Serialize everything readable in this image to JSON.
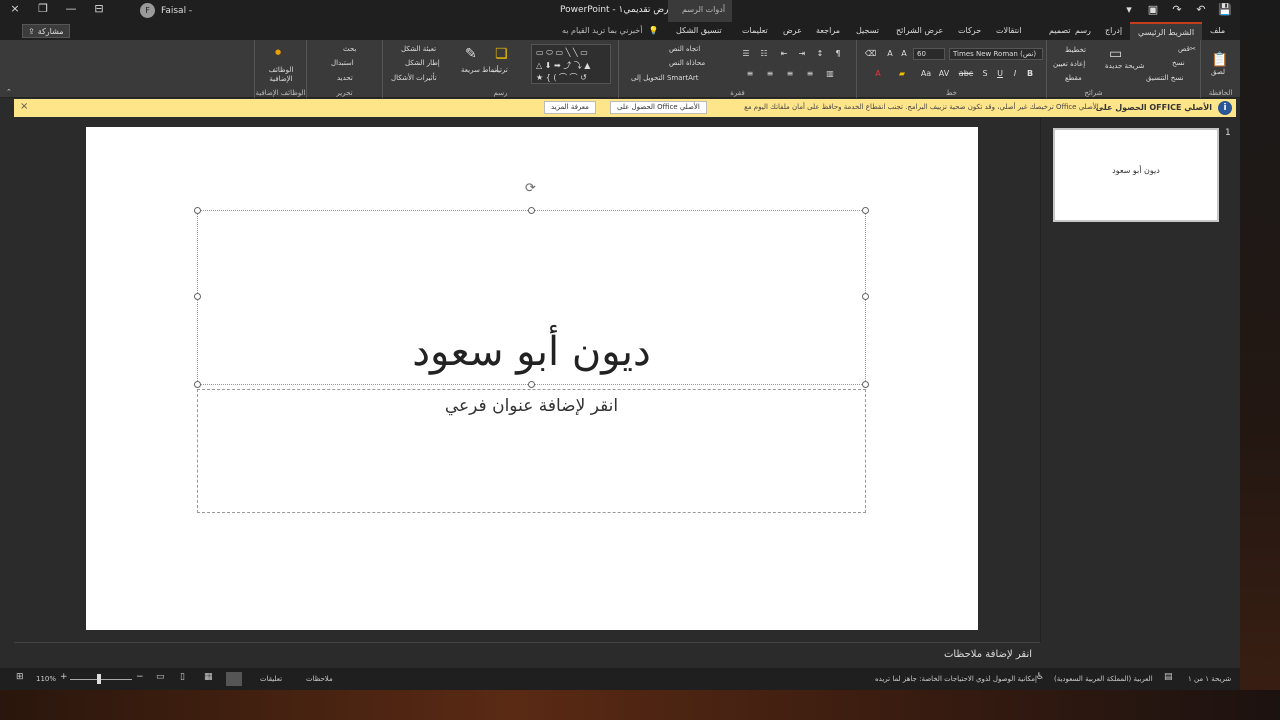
{
  "window": {
    "title": "عرض تقديمي١ - PowerPoint",
    "user_name": "Faisal -",
    "user_initial": "F",
    "contextual_group": "أدوات الرسم",
    "controls": [
      "×",
      "—",
      "□"
    ],
    "quick_access": [
      "💾",
      "↶",
      "↷"
    ]
  },
  "tabs": {
    "file": "ملف",
    "home": "الشريط الرئيسي",
    "insert": "إدراج",
    "draw": "رسم",
    "design": "تصميم",
    "transitions": "انتقالات",
    "animations": "حركات",
    "slideshow": "عرض الشرائح",
    "record": "تسجيل",
    "review": "مراجعة",
    "view": "عرض",
    "help": "تعليمات",
    "shape_format": "تنسيق الشكل",
    "tell_me": "أخبرني بما تريد القيام به",
    "share": "مشاركة"
  },
  "ribbon": {
    "clipboard": {
      "label": "الحافظة",
      "paste": "لصق",
      "cut": "قص",
      "copy": "نسخ",
      "format_painter": "نسخ التنسيق"
    },
    "slides": {
      "label": "شرائح",
      "new_slide": "شريحة جديدة",
      "layout": "تخطيط",
      "reset": "إعادة تعيين",
      "section": "مقطع"
    },
    "font": {
      "label": "خط",
      "font_name": "Times New Roman (نص)",
      "font_size": "60",
      "bold": "B",
      "italic": "I",
      "underline": "U",
      "shadow": "S",
      "strike": "abc",
      "spacing": "AV",
      "change_case": "Aa",
      "grow": "A",
      "shrink": "A"
    },
    "paragraph": {
      "label": "فقرة",
      "text_direction": "اتجاه النص",
      "align_text": "محاذاة النص",
      "smartart": "التحويل إلى SmartArt"
    },
    "drawing": {
      "label": "رسم",
      "arrange": "ترتيب",
      "quick_styles": "أنماط سريعة",
      "shape_fill": "تعبئة الشكل",
      "shape_outline": "إطار الشكل",
      "shape_effects": "تأثيرات الأشكال"
    },
    "editing": {
      "label": "تحرير",
      "find": "بحث",
      "replace": "استبدال",
      "select": "تحديد"
    },
    "addins": {
      "label": "الوظائف الإضافية",
      "button": "الوظائف الإضافية"
    }
  },
  "infobar": {
    "title": "الحصول على OFFICE الأصلي",
    "message": "ترخيصك غير أصلي، وقد تكون ضحية تزييف البرامج. تجنب انقطاع الخدمة وحافظ على أمان ملفاتك اليوم مع Office الأصلي.",
    "button_get": "الحصول على Office الأصلي",
    "button_learn": "معرفة المزيد",
    "close": "×",
    "icon": "i"
  },
  "slide": {
    "title": "ديون أبو سعود",
    "subtitle_placeholder": "انقر لإضافة عنوان فرعي"
  },
  "thumbnails": [
    {
      "number": "1",
      "title": "ديون أبو سعود"
    }
  ],
  "notes": {
    "placeholder": "انقر لإضافة ملاحظات"
  },
  "status": {
    "slide_info": "شريحة ١ من ١",
    "language": "العربية (المملكة العربية السعودية)",
    "accessibility": "إمكانية الوصول لذوي الاحتياجات الخاصة: جاهز لما تريده",
    "notes_btn": "ملاحظات",
    "comments_btn": "تعليقات",
    "zoom": "110%",
    "zoom_minus": "−",
    "zoom_plus": "+"
  }
}
